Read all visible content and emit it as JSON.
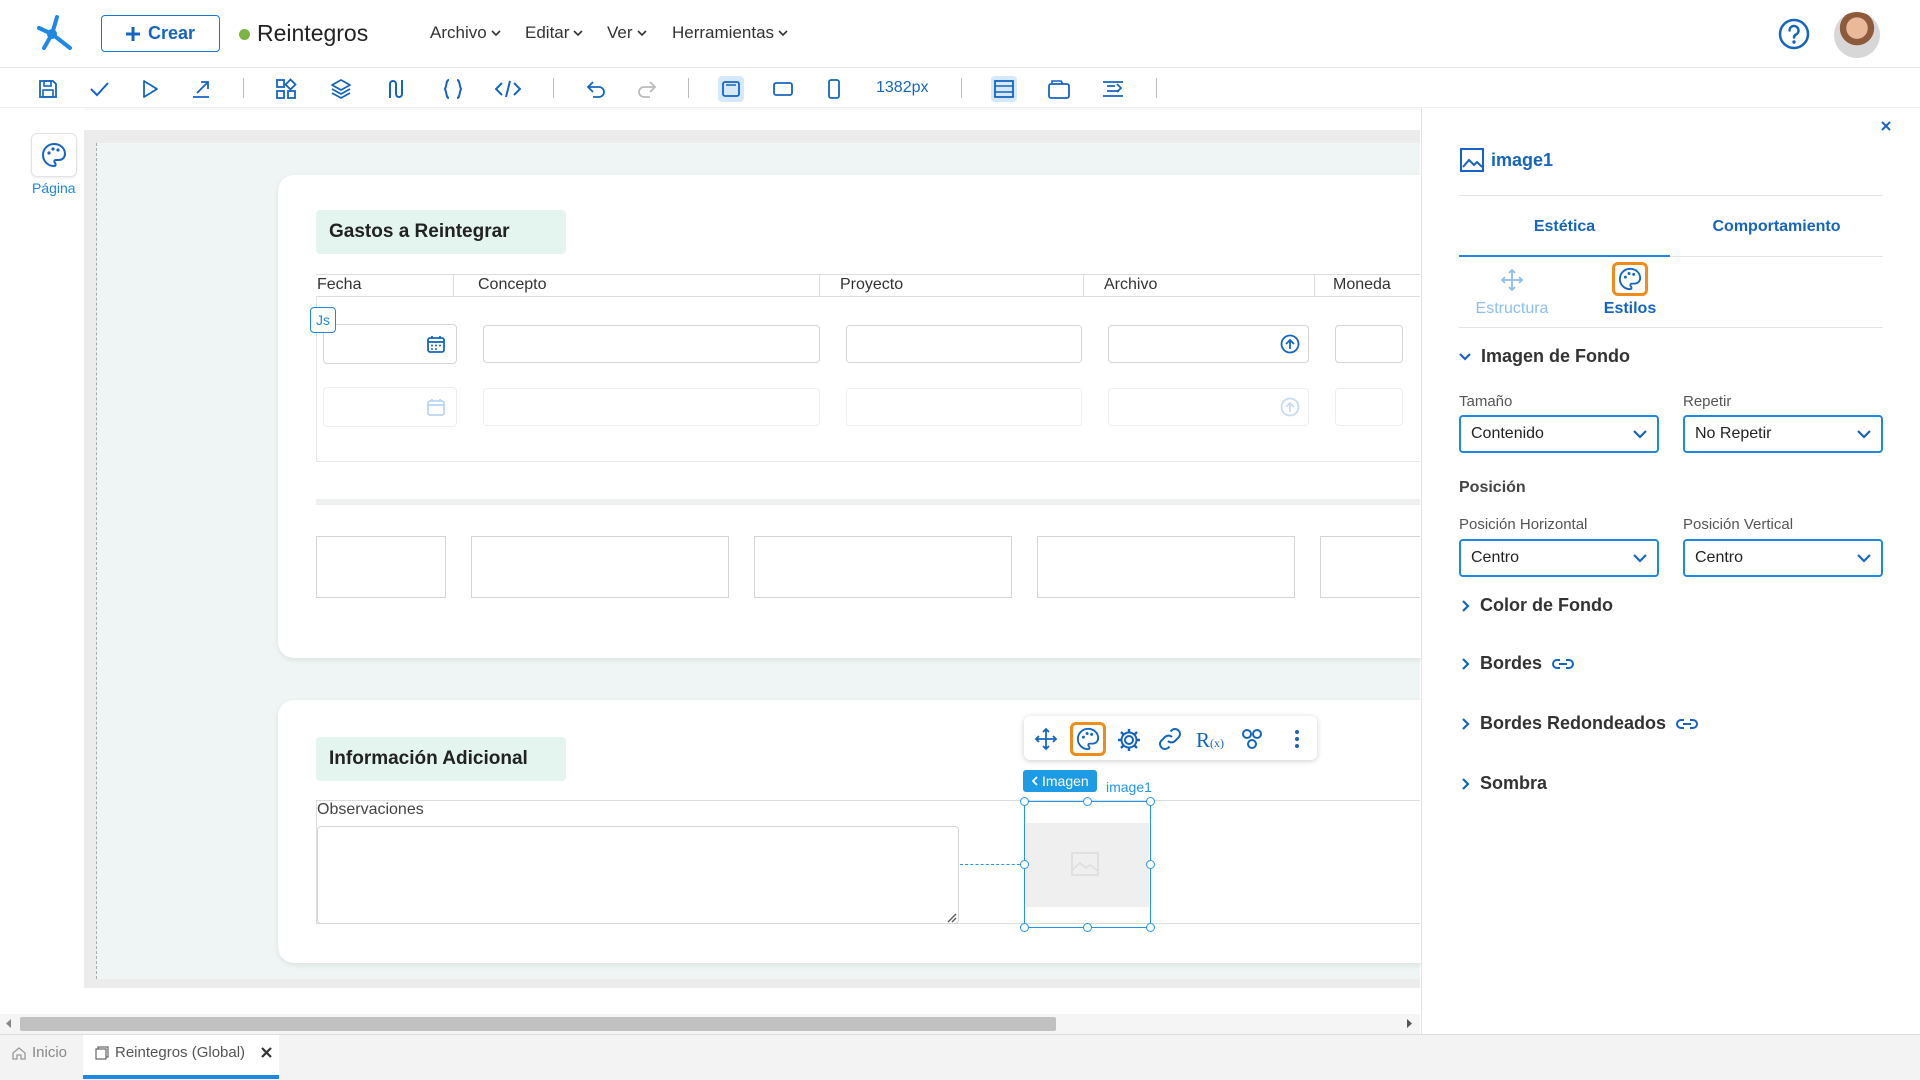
{
  "header": {
    "create_label": "Crear",
    "app_title": "Reintegros",
    "status_color": "#7cb342",
    "menus": [
      "Archivo",
      "Editar",
      "Ver",
      "Herramientas"
    ]
  },
  "toolbar": {
    "width_value": "1382px"
  },
  "left": {
    "page_label": "Página"
  },
  "canvas": {
    "section1": {
      "title": "Gastos a Reintegrar",
      "columns": [
        "Fecha",
        "Concepto",
        "Proyecto",
        "Archivo",
        "Moneda"
      ],
      "js_badge": "Js"
    },
    "section2": {
      "title": "Información Adicional",
      "observations_label": "Observaciones"
    },
    "selection": {
      "chip_label": "Imagen",
      "element_name": "image1"
    }
  },
  "panel": {
    "title": "image1",
    "tabs": [
      "Estética",
      "Comportamiento"
    ],
    "subtabs": [
      "Estructura",
      "Estilos"
    ],
    "section_background_image": "Imagen de Fondo",
    "size_label": "Tamaño",
    "size_value": "Contenido",
    "repeat_label": "Repetir",
    "repeat_value": "No Repetir",
    "position_heading": "Posición",
    "hpos_label": "Posición Horizontal",
    "hpos_value": "Centro",
    "vpos_label": "Posición Vertical",
    "vpos_value": "Centro",
    "collapsed_sections": [
      "Color de Fondo",
      "Bordes",
      "Bordes Redondeados",
      "Sombra"
    ],
    "accent_color": "#1e88e5",
    "highlight_color": "#ef8c1a"
  },
  "bottom_tabs": {
    "home": "Inicio",
    "current": "Reintegros (Global)"
  }
}
